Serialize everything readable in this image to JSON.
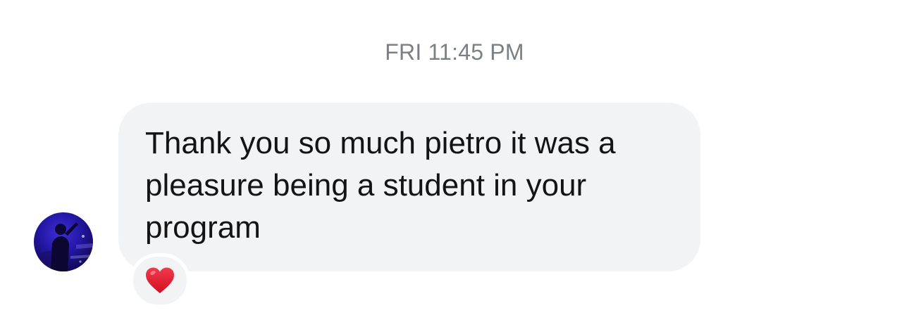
{
  "thread": {
    "timestamp": "FRI 11:45 PM"
  },
  "message": {
    "sender_avatar_icon": "user-avatar",
    "text": "Thank you so much pietro it was a pleasure being a student in your program",
    "bubble_color": "#f2f3f5",
    "reaction": {
      "icon": "red-heart-icon",
      "color": "#e0182d"
    }
  }
}
